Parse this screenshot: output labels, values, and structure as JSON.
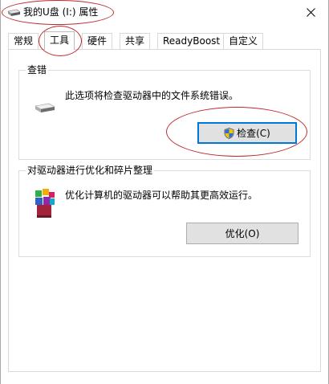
{
  "window": {
    "title": "我的U盘 (I:) 属性",
    "close_glyph": "✕"
  },
  "tabs": [
    {
      "label": "常规"
    },
    {
      "label": "工具"
    },
    {
      "label": "硬件"
    },
    {
      "label": "共享"
    },
    {
      "label": "ReadyBoost"
    },
    {
      "label": "自定义"
    }
  ],
  "active_tab": "工具",
  "error_checking": {
    "title": "查错",
    "description": "此选项将检查驱动器中的文件系统错误。",
    "button_label": "检查(C)",
    "icon": "drive-icon"
  },
  "optimize": {
    "title": "对驱动器进行优化和碎片整理",
    "description": "优化计算机的驱动器可以帮助其更高效运行。",
    "button_label": "优化(O)",
    "icon": "defrag-icon"
  },
  "colors": {
    "annotation_red": "#c0282d",
    "focus_blue": "#0078d7",
    "button_gray": "#e1e1e1"
  }
}
